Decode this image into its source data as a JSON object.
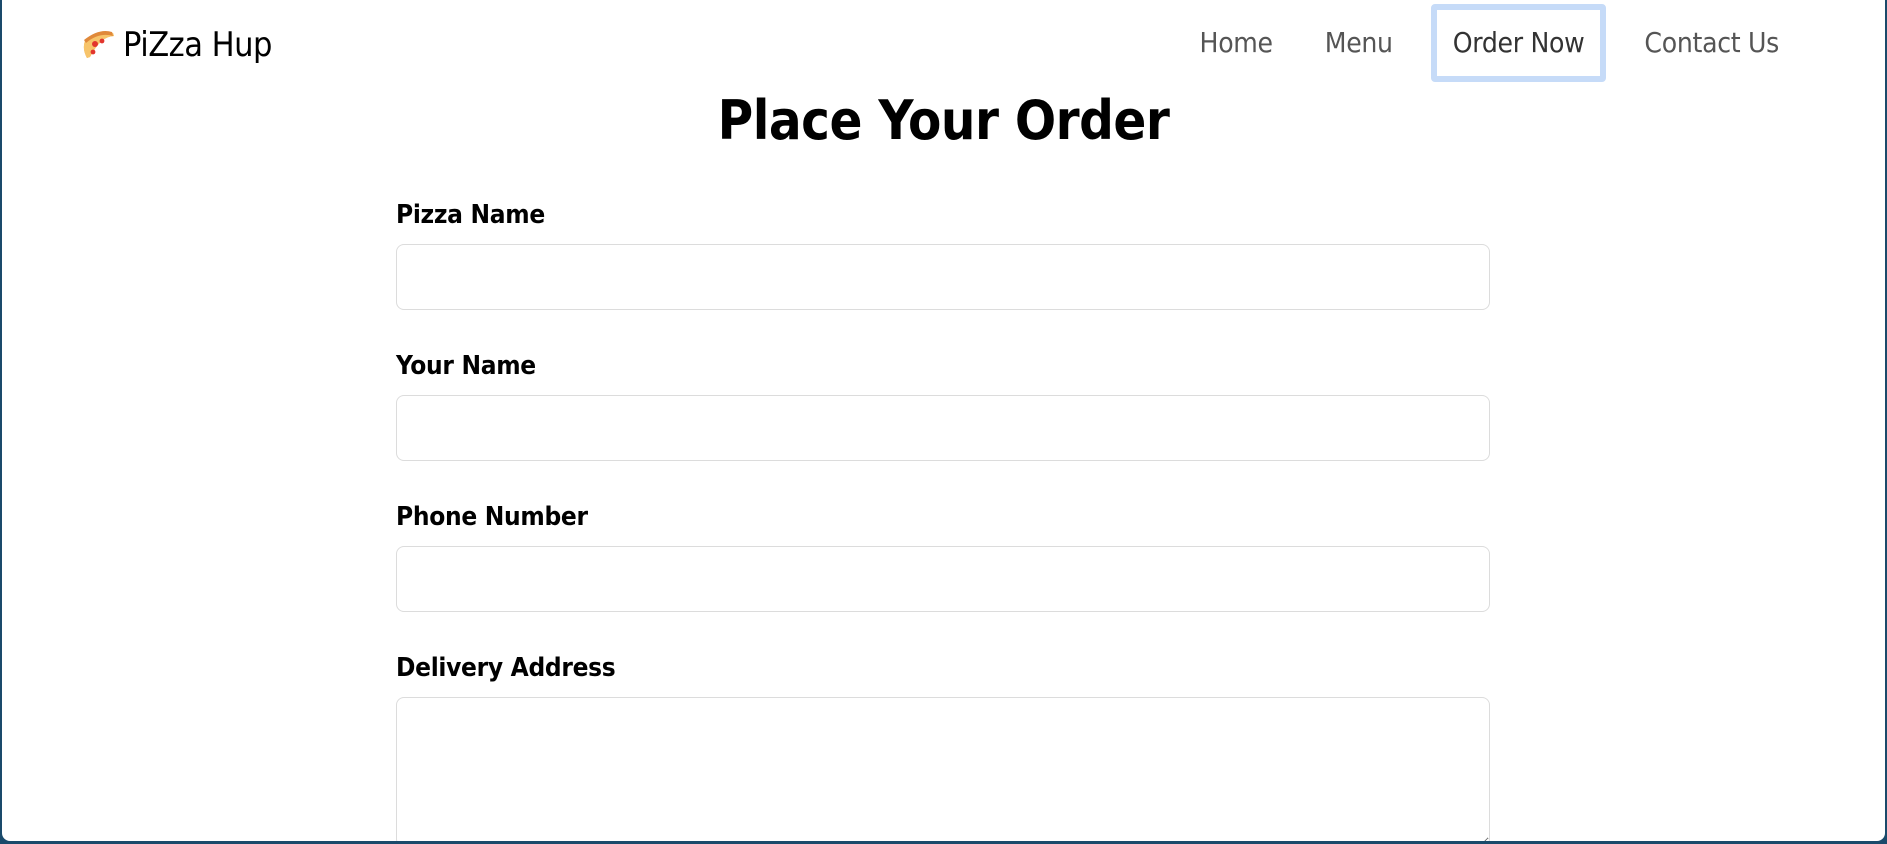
{
  "navbar": {
    "brand": {
      "icon": "pizza-slice-icon",
      "text": "PiZza Hup"
    },
    "links": [
      {
        "label": "Home"
      },
      {
        "label": "Menu"
      },
      {
        "label": "Order Now",
        "focused": true
      },
      {
        "label": "Contact Us"
      }
    ]
  },
  "page": {
    "title": "Place Your Order"
  },
  "form": {
    "pizza_name": {
      "label": "Pizza Name",
      "value": ""
    },
    "your_name": {
      "label": "Your Name",
      "value": ""
    },
    "phone_number": {
      "label": "Phone Number",
      "value": ""
    },
    "delivery_address": {
      "label": "Delivery Address",
      "value": ""
    }
  },
  "colors": {
    "focus_ring": "#c6dbf8",
    "nav_text": "#555555",
    "input_border": "#dcdcdc",
    "window_border": "#1a4a6b"
  }
}
